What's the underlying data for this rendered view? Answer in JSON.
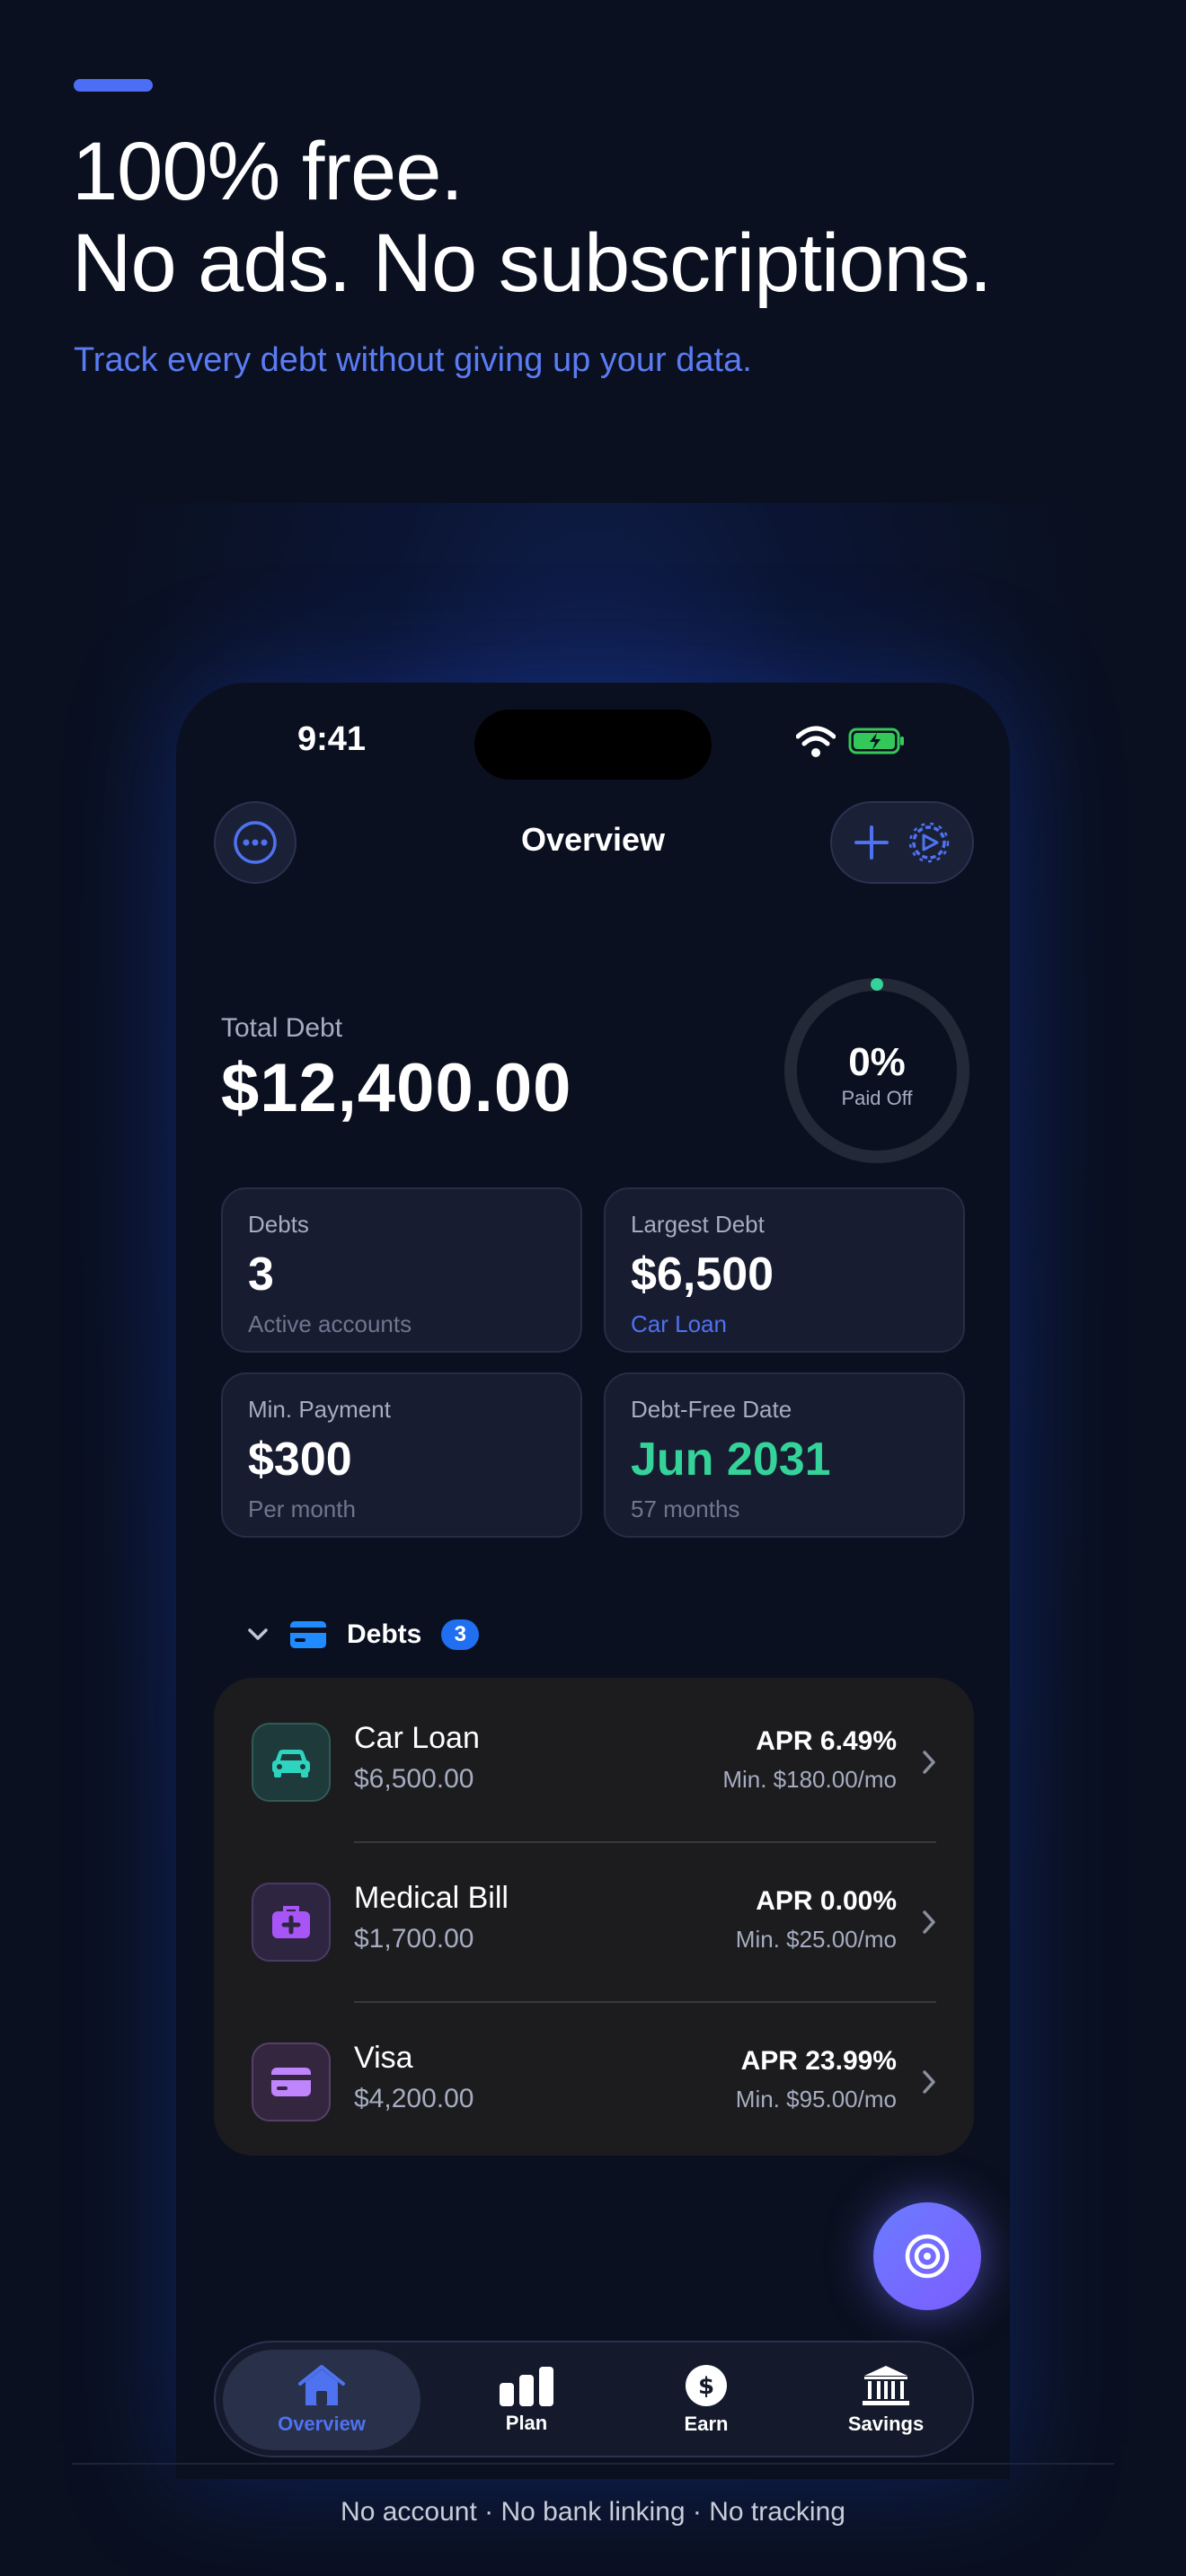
{
  "hero": {
    "line1": "100% free.",
    "line2": "No ads. No subscriptions.",
    "tagline": "Track every debt without giving up your data."
  },
  "status": {
    "time": "9:41"
  },
  "nav": {
    "title": "Overview"
  },
  "summary": {
    "total_label": "Total Debt",
    "total_value": "$12,400.00",
    "paid_pct": "0%",
    "paid_label": "Paid Off",
    "paid_fraction": 0
  },
  "stats": [
    {
      "label": "Debts",
      "value": "3",
      "sub": "Active accounts"
    },
    {
      "label": "Largest Debt",
      "value": "$6,500",
      "sub": "Car Loan"
    },
    {
      "label": "Min. Payment",
      "value": "$300",
      "sub": "Per month"
    },
    {
      "label": "Debt-Free Date",
      "value": "Jun 2031",
      "sub": "57 months"
    }
  ],
  "section": {
    "title": "Debts",
    "count": "3"
  },
  "debts": [
    {
      "name": "Car Loan",
      "amount": "$6,500.00",
      "apr": "APR 6.49%",
      "min": "Min. $180.00/mo",
      "icon": "car-icon",
      "color": "#2dd4bf"
    },
    {
      "name": "Medical Bill",
      "amount": "$1,700.00",
      "apr": "APR 0.00%",
      "min": "Min. $25.00/mo",
      "icon": "medical-kit-icon",
      "color": "#a855f7"
    },
    {
      "name": "Visa",
      "amount": "$4,200.00",
      "apr": "APR 23.99%",
      "min": "Min. $95.00/mo",
      "icon": "credit-card-icon",
      "color": "#c084fc"
    }
  ],
  "tabs": [
    {
      "label": "Overview",
      "icon": "home-icon"
    },
    {
      "label": "Plan",
      "icon": "bar-chart-icon"
    },
    {
      "label": "Earn",
      "icon": "dollar-icon"
    },
    {
      "label": "Savings",
      "icon": "bank-icon"
    }
  ],
  "footer": {
    "text": "No account · No bank linking · No tracking"
  },
  "colors": {
    "accent": "#4f72f0",
    "success": "#34d399",
    "background": "#0a1020"
  }
}
